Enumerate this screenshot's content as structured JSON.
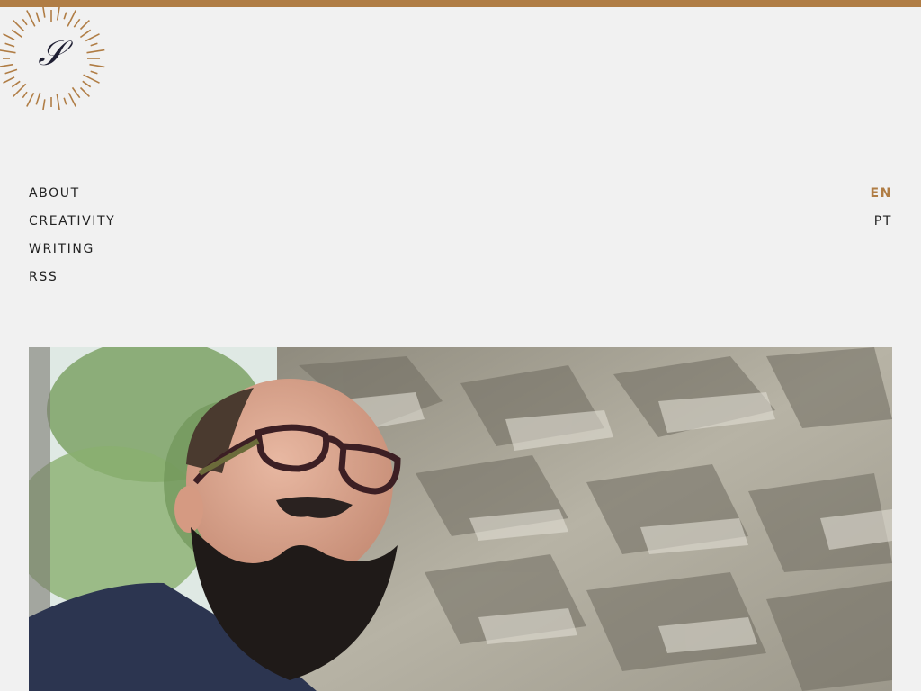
{
  "colors": {
    "accent": "#b07d45",
    "background": "#f1f1f1",
    "text": "#222222"
  },
  "logo": {
    "icon": "monogram-sunburst-icon"
  },
  "nav": {
    "items": [
      {
        "label": "ABOUT"
      },
      {
        "label": "CREATIVITY"
      },
      {
        "label": "WRITING"
      },
      {
        "label": "RSS"
      }
    ]
  },
  "language": {
    "items": [
      {
        "label": "EN",
        "active": true
      },
      {
        "label": "PT",
        "active": false
      }
    ]
  },
  "hero": {
    "image": "portrait-photo"
  }
}
